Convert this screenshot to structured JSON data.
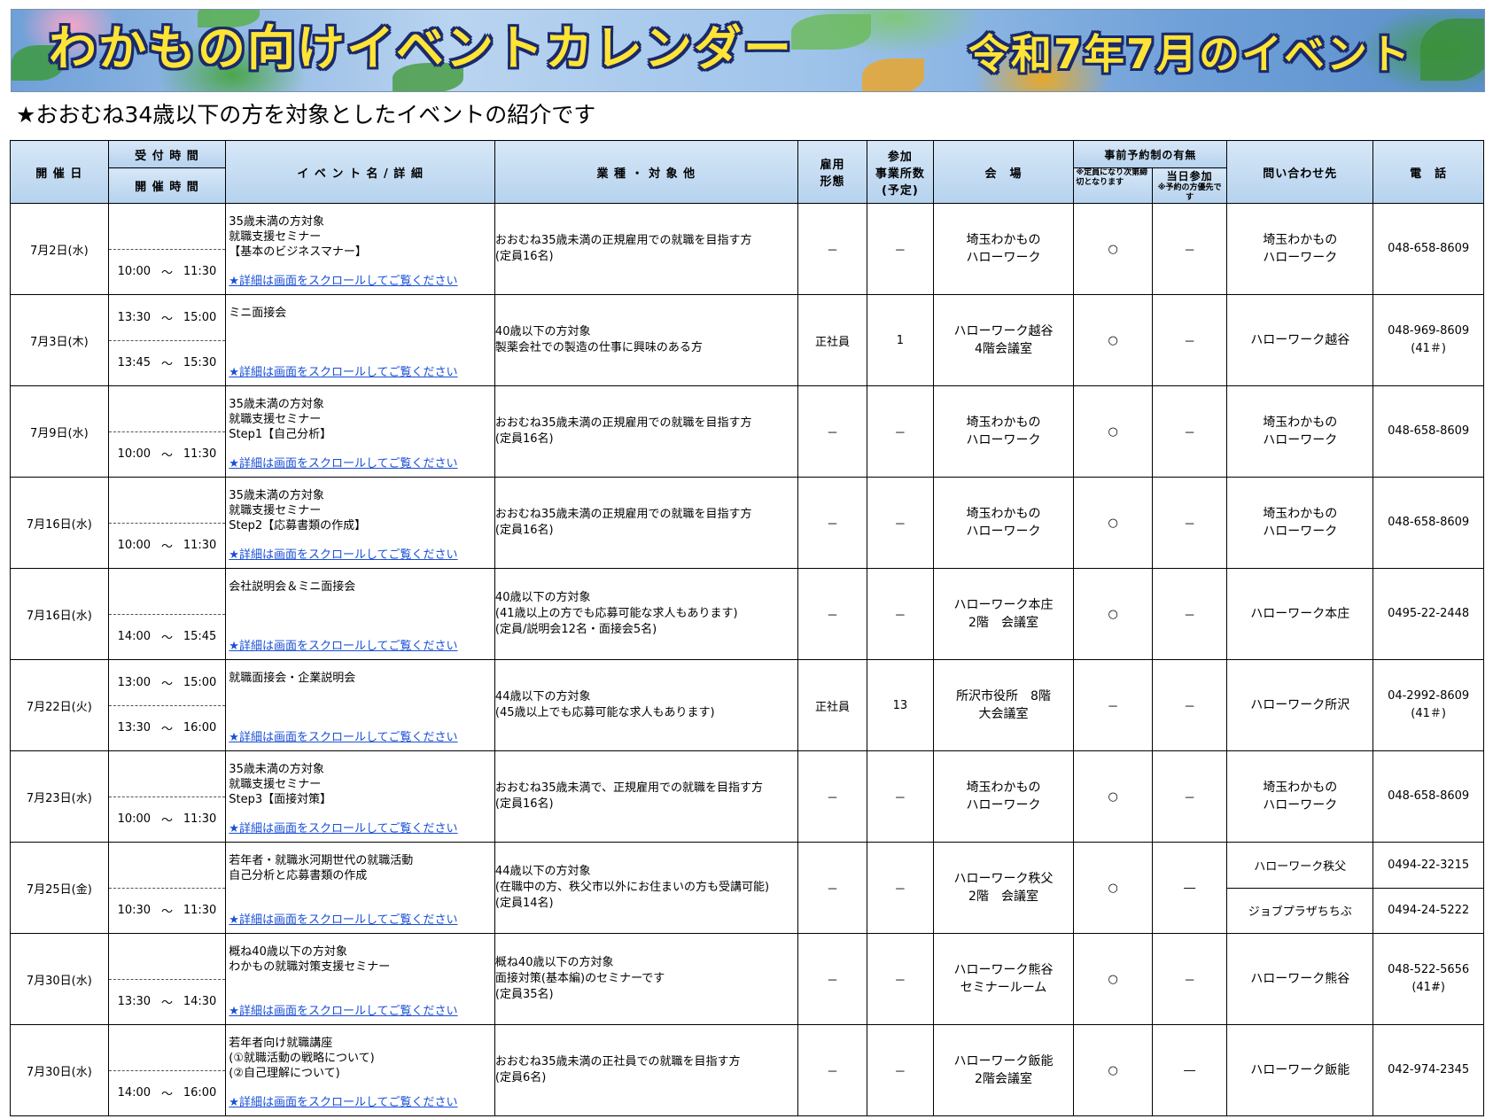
{
  "banner": {
    "title": "わかもの向けイベントカレンダー",
    "subtitle": "令和7年7月のイベント"
  },
  "intro": "★おおむね34歳以下の方を対象としたイベントの紹介です",
  "headers": {
    "date": "開 催 日",
    "reception_time": "受 付 時 間",
    "event_time": "開 催 時 間",
    "event": "イ ベ ン ト 名 / 詳 細",
    "target": "業 種 ・ 対 象 他",
    "employment_1": "雇用",
    "employment_2": "形態",
    "companies_1": "参加",
    "companies_2": "事業所数",
    "companies_3": "(予定)",
    "reservation": "事前予約制の有無",
    "reservation_note": "※定員になり次第締切となります",
    "sameday": "当日参加",
    "sameday_note": "※予約の方優先です",
    "venue": "会　場",
    "contact": "問い合わせ先",
    "phone": "電　話"
  },
  "link_text": "★詳細は画面をスクロールしてご覧ください",
  "rows": [
    {
      "date": "7月2日(水)",
      "rec_start": "",
      "rec_end": "",
      "start": "10:00",
      "end": "11:30",
      "rec_tilde": "",
      "tilde": "～",
      "event": [
        "35歳未満の方対象",
        "就職支援セミナー",
        "【基本のビジネスマナー】"
      ],
      "target": [
        "おおむね35歳未満の正規雇用での就職を目指す方",
        "(定員16名)"
      ],
      "employment": "－",
      "companies": "－",
      "venue": [
        "埼玉わかもの",
        "ハローワーク"
      ],
      "reservation": "○",
      "sameday": "－",
      "contact": [
        "埼玉わかもの",
        "ハローワーク"
      ],
      "phone": [
        "048-658-8609"
      ]
    },
    {
      "date": "7月3日(木)",
      "rec_start": "13:30",
      "rec_end": "15:00",
      "start": "13:45",
      "end": "15:30",
      "rec_tilde": "～",
      "tilde": "～",
      "event": [
        "ミニ面接会"
      ],
      "target": [
        "40歳以下の方対象",
        "製薬会社での製造の仕事に興味のある方"
      ],
      "employment": "正社員",
      "companies": "1",
      "venue": [
        "ハローワーク越谷",
        "4階会議室"
      ],
      "reservation": "○",
      "sameday": "－",
      "contact": [
        "ハローワーク越谷"
      ],
      "phone": [
        "048-969-8609",
        "(41＃)"
      ]
    },
    {
      "date": "7月9日(水)",
      "rec_start": "",
      "rec_end": "",
      "start": "10:00",
      "end": "11:30",
      "rec_tilde": "",
      "tilde": "～",
      "event": [
        "35歳未満の方対象",
        "就職支援セミナー",
        "Step1【自己分析】"
      ],
      "target": [
        "おおむね35歳未満の正規雇用での就職を目指す方",
        "(定員16名)"
      ],
      "employment": "－",
      "companies": "－",
      "venue": [
        "埼玉わかもの",
        "ハローワーク"
      ],
      "reservation": "○",
      "sameday": "－",
      "contact": [
        "埼玉わかもの",
        "ハローワーク"
      ],
      "phone": [
        "048-658-8609"
      ]
    },
    {
      "date": "7月16日(水)",
      "rec_start": "",
      "rec_end": "",
      "start": "10:00",
      "end": "11:30",
      "rec_tilde": "",
      "tilde": "～",
      "event": [
        "35歳未満の方対象",
        "就職支援セミナー",
        "Step2【応募書類の作成】"
      ],
      "target": [
        "おおむね35歳未満の正規雇用での就職を目指す方",
        "(定員16名)"
      ],
      "employment": "－",
      "companies": "－",
      "venue": [
        "埼玉わかもの",
        "ハローワーク"
      ],
      "reservation": "○",
      "sameday": "－",
      "contact": [
        "埼玉わかもの",
        "ハローワーク"
      ],
      "phone": [
        "048-658-8609"
      ]
    },
    {
      "date": "7月16日(水)",
      "rec_start": "",
      "rec_end": "",
      "start": "14:00",
      "end": "15:45",
      "rec_tilde": "",
      "tilde": "～",
      "event": [
        "会社説明会＆ミニ面接会"
      ],
      "target": [
        "40歳以下の方対象",
        "(41歳以上の方でも応募可能な求人もあります)",
        "(定員/説明会12名・面接会5名)"
      ],
      "employment": "－",
      "companies": "－",
      "venue": [
        "ハローワーク本庄",
        "2階　会議室"
      ],
      "reservation": "○",
      "sameday": "－",
      "contact": [
        "ハローワーク本庄"
      ],
      "phone": [
        "0495-22-2448"
      ]
    },
    {
      "date": "7月22日(火)",
      "rec_start": "13:00",
      "rec_end": "15:00",
      "start": "13:30",
      "end": "16:00",
      "rec_tilde": "～",
      "tilde": "～",
      "event": [
        "就職面接会・企業説明会"
      ],
      "target": [
        "44歳以下の方対象",
        "(45歳以上でも応募可能な求人もあります)"
      ],
      "employment": "正社員",
      "companies": "13",
      "venue": [
        "所沢市役所　8階",
        "大会議室"
      ],
      "reservation": "－",
      "sameday": "－",
      "contact": [
        "ハローワーク所沢"
      ],
      "phone": [
        "04-2992-8609",
        "(41＃)"
      ]
    },
    {
      "date": "7月23日(水)",
      "rec_start": "",
      "rec_end": "",
      "start": "10:00",
      "end": "11:30",
      "rec_tilde": "",
      "tilde": "～",
      "event": [
        "35歳未満の方対象",
        "就職支援セミナー",
        "Step3【面接対策】"
      ],
      "target": [
        "おおむね35歳未満で、正規雇用での就職を目指す方",
        "(定員16名)"
      ],
      "employment": "－",
      "companies": "－",
      "venue": [
        "埼玉わかもの",
        "ハローワーク"
      ],
      "reservation": "○",
      "sameday": "－",
      "contact": [
        "埼玉わかもの",
        "ハローワーク"
      ],
      "phone": [
        "048-658-8609"
      ]
    },
    {
      "date": "7月25日(金)",
      "rec_start": "",
      "rec_end": "",
      "start": "10:30",
      "end": "11:30",
      "rec_tilde": "",
      "tilde": "～",
      "event": [
        "若年者・就職氷河期世代の就職活動",
        "自己分析と応募書類の作成"
      ],
      "target": [
        "44歳以下の方対象",
        "(在職中の方、秩父市以外にお住まいの方も受講可能)",
        "(定員14名)"
      ],
      "employment": "－",
      "companies": "－",
      "venue": [
        "ハローワーク秩父",
        "2階　会議室"
      ],
      "reservation": "○",
      "sameday": "―",
      "contact_split": [
        "ハローワーク秩父",
        "ジョブプラザちちぶ"
      ],
      "phone_split": [
        "0494-22-3215",
        "0494-24-5222"
      ]
    },
    {
      "date": "7月30日(水)",
      "rec_start": "",
      "rec_end": "",
      "start": "13:30",
      "end": "14:30",
      "rec_tilde": "",
      "tilde": "～",
      "event": [
        "概ね40歳以下の方対象",
        "わかもの就職対策支援セミナー"
      ],
      "target": [
        "概ね40歳以下の方対象",
        "面接対策(基本編)のセミナーです",
        "(定員35名)"
      ],
      "employment": "－",
      "companies": "－",
      "venue": [
        "ハローワーク熊谷",
        "セミナールーム"
      ],
      "reservation": "○",
      "sameday": "－",
      "contact": [
        "ハローワーク熊谷"
      ],
      "phone": [
        "048-522-5656",
        "(41#)"
      ]
    },
    {
      "date": "7月30日(水)",
      "rec_start": "",
      "rec_end": "",
      "start": "14:00",
      "end": "16:00",
      "rec_tilde": "",
      "tilde": "～",
      "event": [
        "若年者向け就職講座",
        "(①就職活動の戦略について)",
        "(②自己理解について)"
      ],
      "target": [
        "おおむね35歳未満の正社員での就職を目指す方",
        "(定員6名)"
      ],
      "employment": "－",
      "companies": "－",
      "venue": [
        "ハローワーク飯能",
        "2階会議室"
      ],
      "reservation": "○",
      "sameday": "―",
      "contact": [
        "ハローワーク飯能"
      ],
      "phone": [
        "042-974-2345"
      ]
    }
  ],
  "colors": {
    "header_bg": "#b5d2ee",
    "link": "#1a4fd6",
    "title_fill": "#ffe436",
    "title_outline": "#1a2a6b"
  }
}
